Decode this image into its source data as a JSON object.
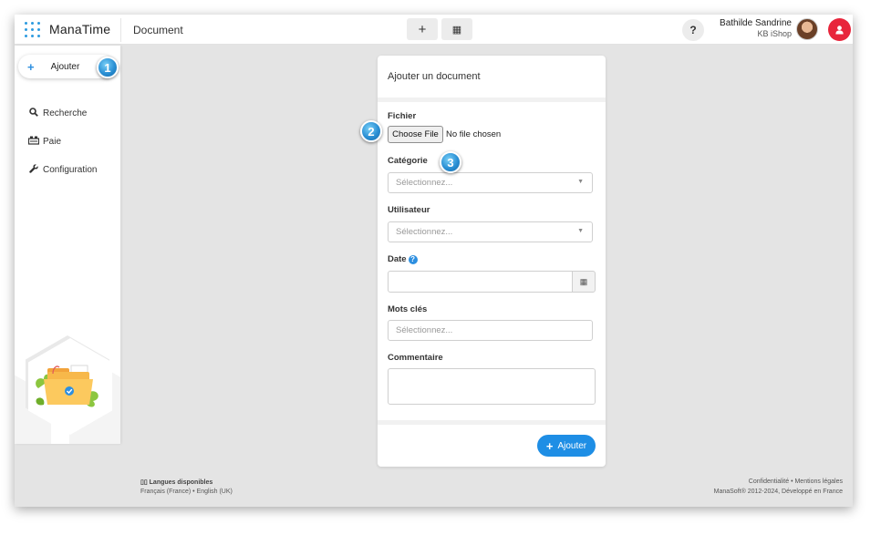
{
  "app": {
    "logo_text": "ManaTime",
    "page_title": "Document",
    "accent_color": "#2d8fe0",
    "danger_color": "#e8253b"
  },
  "topbar": {
    "add_icon": "plus-icon",
    "add_glyph": "+",
    "calendar_icon": "calendar-icon",
    "calendar_glyph": "▦",
    "help_glyph": "?",
    "user_name": "Bathilde Sandrine",
    "user_company": "KB iShop"
  },
  "sidebar": {
    "add_label": "Ajouter",
    "items": [
      {
        "label": "Recherche",
        "icon": "search-icon"
      },
      {
        "label": "Paie",
        "icon": "payroll-icon"
      },
      {
        "label": "Configuration",
        "icon": "wrench-icon"
      }
    ]
  },
  "form": {
    "title": "Ajouter un document",
    "file_label": "Fichier",
    "file_button": "Choose File",
    "file_status": "No file chosen",
    "category_label": "Catégorie",
    "category_placeholder": "Sélectionnez...",
    "user_label": "Utilisateur",
    "user_placeholder": "Sélectionnez...",
    "date_label": "Date",
    "date_value": "",
    "keywords_label": "Mots clés",
    "keywords_placeholder": "Sélectionnez...",
    "comment_label": "Commentaire",
    "comment_value": "",
    "submit_label": "Ajouter"
  },
  "callouts": [
    "1",
    "2",
    "3"
  ],
  "footer": {
    "languages_title": "Langues disponibles",
    "languages": "Français (France) • English (UK)",
    "links": "Confidentialité • Mentions légales",
    "copyright": "ManaSoft® 2012-2024, Développé en France"
  }
}
